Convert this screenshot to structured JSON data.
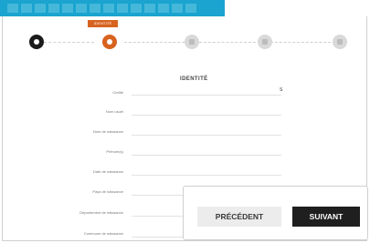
{
  "stepper": {
    "active_tag": "IDENTITÉ",
    "steps": [
      {
        "state": "completed"
      },
      {
        "state": "active"
      },
      {
        "state": "pending"
      },
      {
        "state": "pending"
      },
      {
        "state": "pending"
      }
    ]
  },
  "form": {
    "section_title": "IDENTITÉ",
    "rows": [
      {
        "label": "Civilité"
      },
      {
        "label": "Nom usuel"
      },
      {
        "label": "Nom de naissance"
      },
      {
        "label": "Prénom(s)"
      },
      {
        "label": "Date de naissance"
      },
      {
        "label": "Pays de naissance"
      },
      {
        "label": "Département de naissance"
      },
      {
        "label": "Commune de naissance"
      }
    ],
    "partial_value": "S"
  },
  "actions": {
    "previous_label": "PRÉCÉDENT",
    "next_label": "SUIVANT"
  },
  "colors": {
    "banner": "#1aa4cf",
    "accent": "#d7631f",
    "completed": "#1b1b1b",
    "pending": "#d9d9d9",
    "next_button": "#1f1f1f"
  }
}
